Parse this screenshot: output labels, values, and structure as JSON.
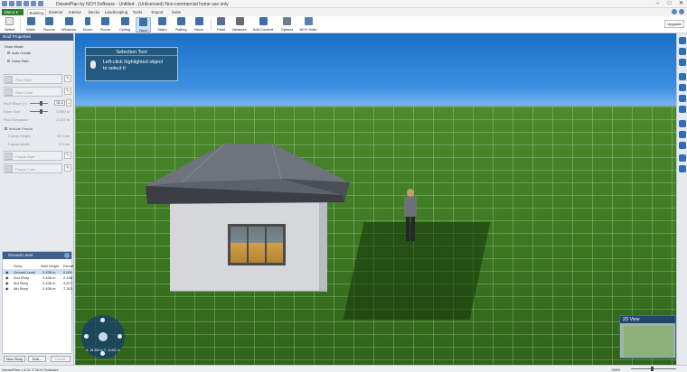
{
  "window": {
    "title": "DreamPlan by NCH Software - Untitled - (Unlicensed) Non-commercial home use only",
    "minimize": "–",
    "maximize": "□",
    "close": "✕"
  },
  "menu": {
    "label": "Menu ▾"
  },
  "tabs": [
    "Building",
    "Exterior",
    "Interior",
    "Decks",
    "Landscaping",
    "Tools",
    "Export",
    "Suite"
  ],
  "ribbon": {
    "buttons": [
      "Select",
      "Walls",
      "Rooms",
      "Windows",
      "Doors",
      "Floors",
      "Ceiling",
      "Roof",
      "Stairs",
      "Railing",
      "Block",
      "Paint",
      "Measure",
      "Add Content",
      "Options",
      "NCH Suite"
    ],
    "upgrade": "Upgrade"
  },
  "left_panel": {
    "title": "Roof Properties",
    "draw_mode_label": "Draw Mode:",
    "auto_create": "Auto Create",
    "draw_path": "Draw Path",
    "roof_style": "Roof Style",
    "roof_color": "Roof Color",
    "roof_slope_label": "Roof Slope (°):",
    "roof_slope_value": "26.0",
    "eave_size_label": "Eave Size:",
    "eave_size_value": "0.300 m",
    "roof_elevation_label": "Roof Elevation:",
    "roof_elevation_value": "2.437 m",
    "include_fascia": "Include Fascia",
    "fascia_height_label": "Fascia Height:",
    "fascia_height_value": "15.2 cm",
    "fascia_width_label": "Fascia Width:",
    "fascia_width_value": "2.5 cm",
    "fascia_style": "Fascia Style",
    "fascia_color": "Fascia Color"
  },
  "levels": {
    "title": "Ground Level",
    "columns": [
      "Story",
      "Wall Height",
      "Elevat"
    ],
    "rows": [
      {
        "story": "Ground Level",
        "wall_height": "2.438 m",
        "elevation": "0.000"
      },
      {
        "story": "2nd Story",
        "wall_height": "2.438 m",
        "elevation": "2.438"
      },
      {
        "story": "3rd Story",
        "wall_height": "2.438 m",
        "elevation": "4.877"
      },
      {
        "story": "4th Story",
        "wall_height": "2.438 m",
        "elevation": "7.315"
      }
    ],
    "buttons": [
      "New Story",
      "Edit...",
      "Delete"
    ]
  },
  "tooltip": {
    "title": "Selection Tool",
    "line1": "Left-click highlighted object",
    "line2": "to select it"
  },
  "navigation": {
    "coords": "X: 18.396 m   Y: -8.401 m"
  },
  "minimap": {
    "title": "2D View"
  },
  "statusbar": {
    "text": "DreamPlan v 8.01 © NCH Software",
    "zoom": "786%"
  },
  "colors": {
    "accent": "#3f5f8a",
    "menu_green": "#2e7d32",
    "sky": "#3c8ee0",
    "grass": "#3d7a22",
    "roof": "#5a5e66",
    "wall": "#d5d7da"
  }
}
